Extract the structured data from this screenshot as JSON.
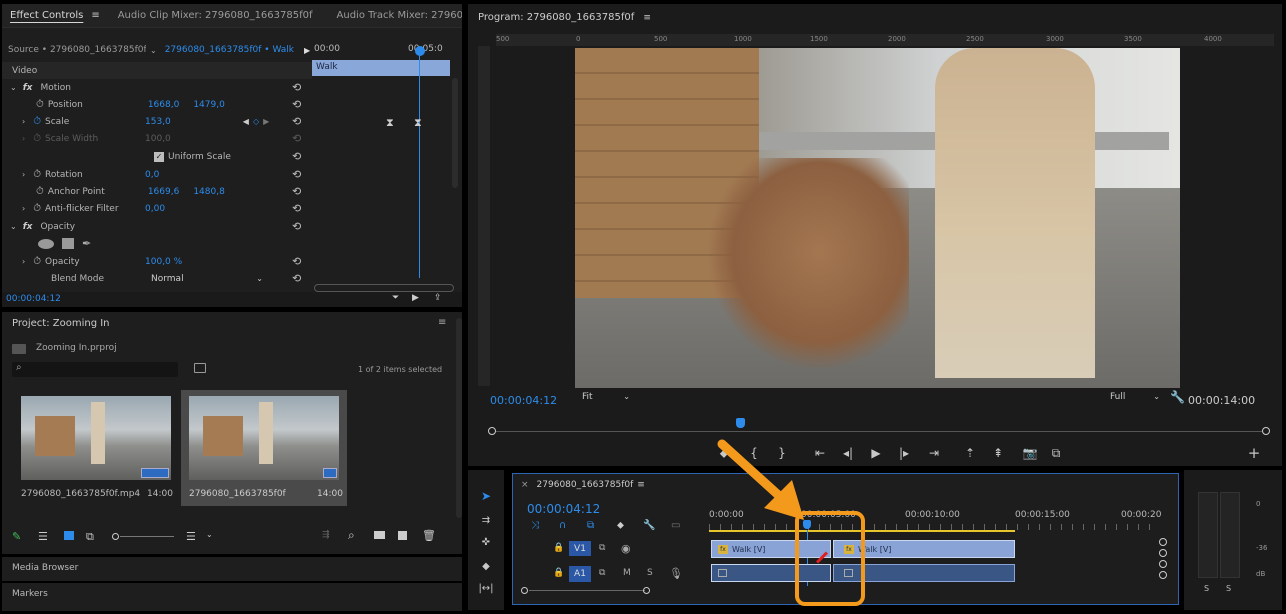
{
  "effect_panel": {
    "tabs": [
      "Effect Controls",
      "Audio Clip Mixer: 2796080_1663785f0f",
      "Audio Track Mixer: 2796080_16637"
    ],
    "more_tabs": "»",
    "source_label": "Source • 2796080_1663785f0f...",
    "sequence_label": "2796080_1663785f0f • Walk",
    "ruler_start": "00:00",
    "ruler_end": "00:05:0",
    "clip_name": "Walk",
    "section_video": "Video",
    "motion": "Motion",
    "position_label": "Position",
    "position_x": "1668,0",
    "position_y": "1479,0",
    "scale_label": "Scale",
    "scale_value": "153,0",
    "scale_width_label": "Scale Width",
    "scale_width_value": "100,0",
    "uniform_scale": "Uniform Scale",
    "rotation_label": "Rotation",
    "rotation_value": "0,0",
    "anchor_label": "Anchor Point",
    "anchor_x": "1669,6",
    "anchor_y": "1480,8",
    "antiflicker_label": "Anti-flicker Filter",
    "antiflicker_value": "0,00",
    "opacity_section": "Opacity",
    "opacity_label": "Opacity",
    "opacity_value": "100,0 %",
    "blend_label": "Blend Mode",
    "blend_value": "Normal",
    "timecode": "00:00:04:12"
  },
  "project_panel": {
    "title": "Project: Zooming In",
    "file": "Zooming In.prproj",
    "search_placeholder": "",
    "selection_info": "1 of 2 items selected",
    "items": [
      {
        "name": "2796080_1663785f0f.mp4",
        "duration": "14:00"
      },
      {
        "name": "2796080_1663785f0f",
        "duration": "14:00"
      }
    ],
    "media_browser": "Media Browser",
    "markers": "Markers"
  },
  "program_monitor": {
    "title": "Program: 2796080_1663785f0f",
    "ruler_ticks": [
      "500",
      "0",
      "500",
      "1000",
      "1500",
      "2000",
      "2500",
      "3000",
      "3500",
      "4000"
    ],
    "timecode": "00:00:04:12",
    "fit": "Fit",
    "full": "Full",
    "duration": "00:00:14:00",
    "playhead_fraction": 0.318
  },
  "timeline": {
    "sequence": "2796080_1663785f0f",
    "timecode": "00:00:04:12",
    "ruler": [
      "0:00:00",
      "00:00:05:00",
      "00:00:10:00",
      "00:00:15:00",
      "00:00:20"
    ],
    "v1": "V1",
    "a1": "A1",
    "m": "M",
    "s": "S",
    "clip1": "Walk [V]",
    "clip2": "Walk [V]",
    "fx": "fx"
  },
  "meters": {
    "scale": [
      "0",
      "-36",
      "dB"
    ],
    "solo1": "S",
    "solo2": "S"
  },
  "colors": {
    "accent": "#2d8ceb",
    "annotation": "#f39a1c",
    "clip_video": "#8aa3d6",
    "clip_audio": "#3a5685"
  }
}
